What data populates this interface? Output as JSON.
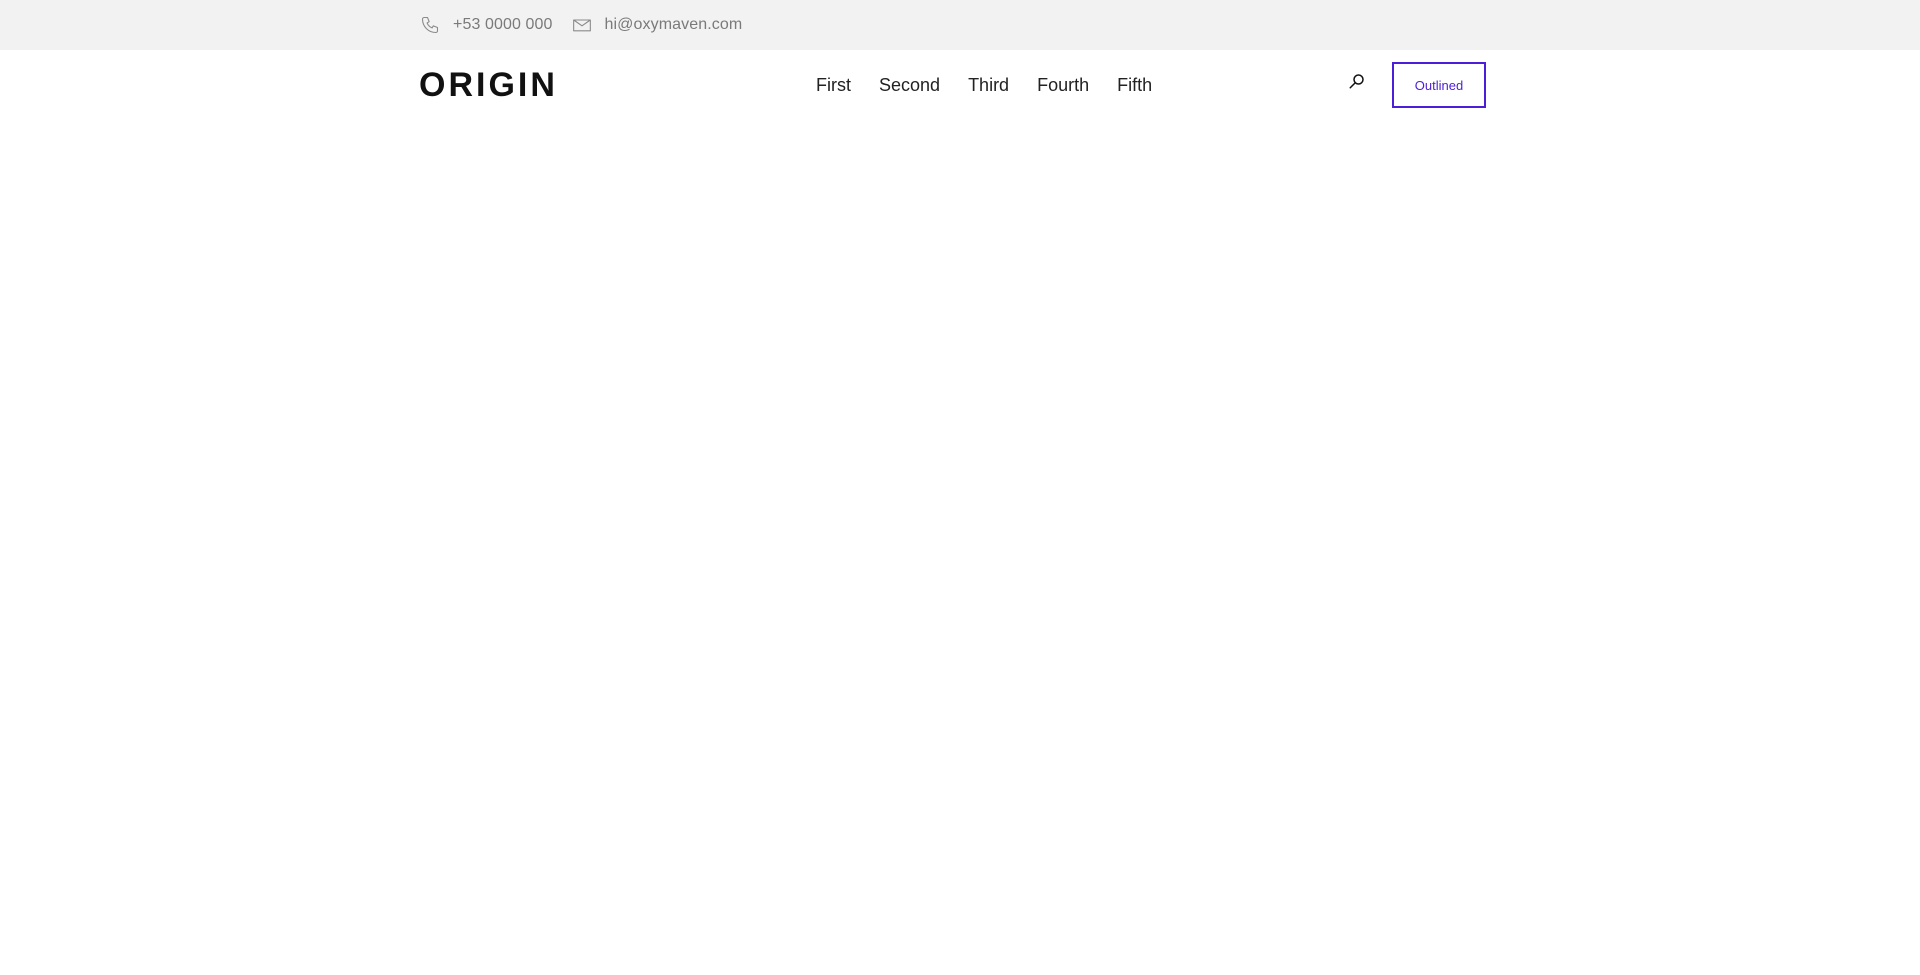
{
  "topbar": {
    "phone": {
      "icon": "phone-icon",
      "text": "+53 0000 000"
    },
    "email": {
      "icon": "mail-icon",
      "text": "hi@oxymaven.com"
    }
  },
  "header": {
    "logo": "ORIGIN",
    "nav": [
      {
        "label": "First"
      },
      {
        "label": "Second"
      },
      {
        "label": "Third"
      },
      {
        "label": "Fourth"
      },
      {
        "label": "Fifth"
      }
    ],
    "search_icon": "search-icon",
    "cta_label": "Outlined"
  },
  "colors": {
    "topbar_bg": "#f2f2f2",
    "accent": "#4c1ed8",
    "text_muted": "#7a7a7a",
    "text_dark": "#222222"
  }
}
